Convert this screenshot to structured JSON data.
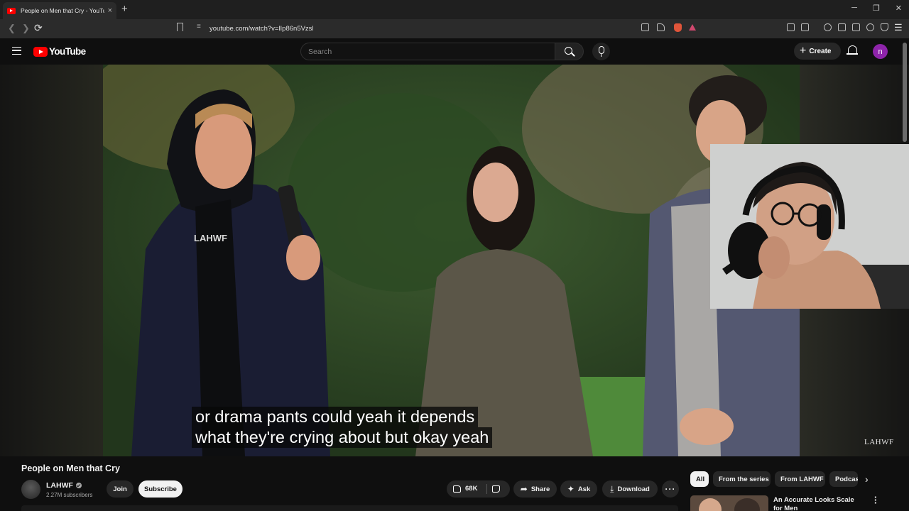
{
  "browser": {
    "tab_title": "People on Men that Cry - YouTube",
    "tab_close": "×",
    "new_tab": "+",
    "url": "youtube.com/watch?v=lIp86n5Vzsl",
    "window_controls": [
      "─",
      "❐",
      "✕"
    ]
  },
  "header": {
    "logo_text": "YouTube",
    "search_placeholder": "Search",
    "create_label": "Create",
    "avatar_letter": "n"
  },
  "video": {
    "caption_line1": "or drama pants could yeah it depends",
    "caption_line2": "what they're crying about but okay yeah",
    "watermark": "LAHWF",
    "shirt_text": "LAHWF"
  },
  "details": {
    "title": "People on Men that Cry",
    "channel_name": "LAHWF",
    "subscribers": "2.27M subscribers",
    "join_label": "Join",
    "subscribe_label": "Subscribe",
    "likes": "68K",
    "share_label": "Share",
    "ask_label": "Ask",
    "download_label": "Download"
  },
  "sidebar": {
    "chips": [
      "All",
      "From the series",
      "From LAHWF",
      "Podcasts"
    ],
    "recommendation_title": "An Accurate Looks Scale for Men"
  },
  "icons": [
    "hamburger-icon",
    "search-icon",
    "mic-icon",
    "bell-icon",
    "like-icon",
    "dislike-icon",
    "share-icon",
    "ask-icon",
    "download-icon",
    "more-icon",
    "chevron-right-icon"
  ]
}
